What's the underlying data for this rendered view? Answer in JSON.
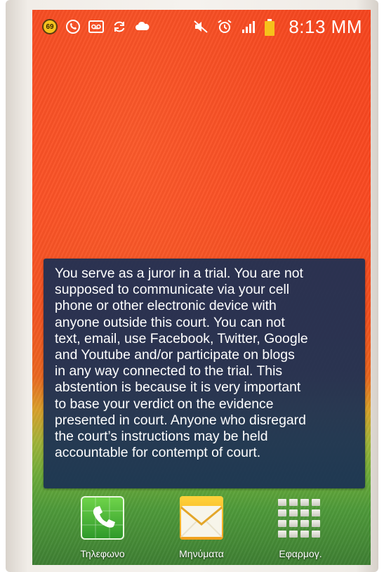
{
  "status_bar": {
    "notification_count": "69",
    "time": "8:13 MM",
    "left_icons": [
      "notification-badge-icon",
      "viber-icon",
      "voicemail-icon",
      "sync-icon",
      "cloud-icon"
    ],
    "right_icons": [
      "mute-icon",
      "alarm-icon",
      "signal-icon",
      "battery-icon"
    ],
    "battery_color": "#f6c21b"
  },
  "notice": {
    "text": "You serve as a juror in a trial. You are not\nsupposed to communicate via your cell\nphone or other electronic device with\nanyone outside this court. You can not\ntext, email, use Facebook, Twitter, Google\nand Youtube and/or participate on blogs\nin any way connected to the trial. This\nabstention is because it is very important\nto base your verdict on the evidence\npresented in court. Anyone who disregard\nthe court’s instructions may be held\naccountable for contempt of court."
  },
  "dock": {
    "apps": [
      {
        "label": "Τηλεφωνο",
        "icon": "phone-icon"
      },
      {
        "label": "Μηνύματα",
        "icon": "messages-icon"
      },
      {
        "label": "Εφαρμογ.",
        "icon": "apps-grid-icon"
      }
    ]
  },
  "colors": {
    "wallpaper_top": "#f6461f",
    "wallpaper_bottom": "#3f7f33",
    "notice_background": "#1a3055"
  }
}
